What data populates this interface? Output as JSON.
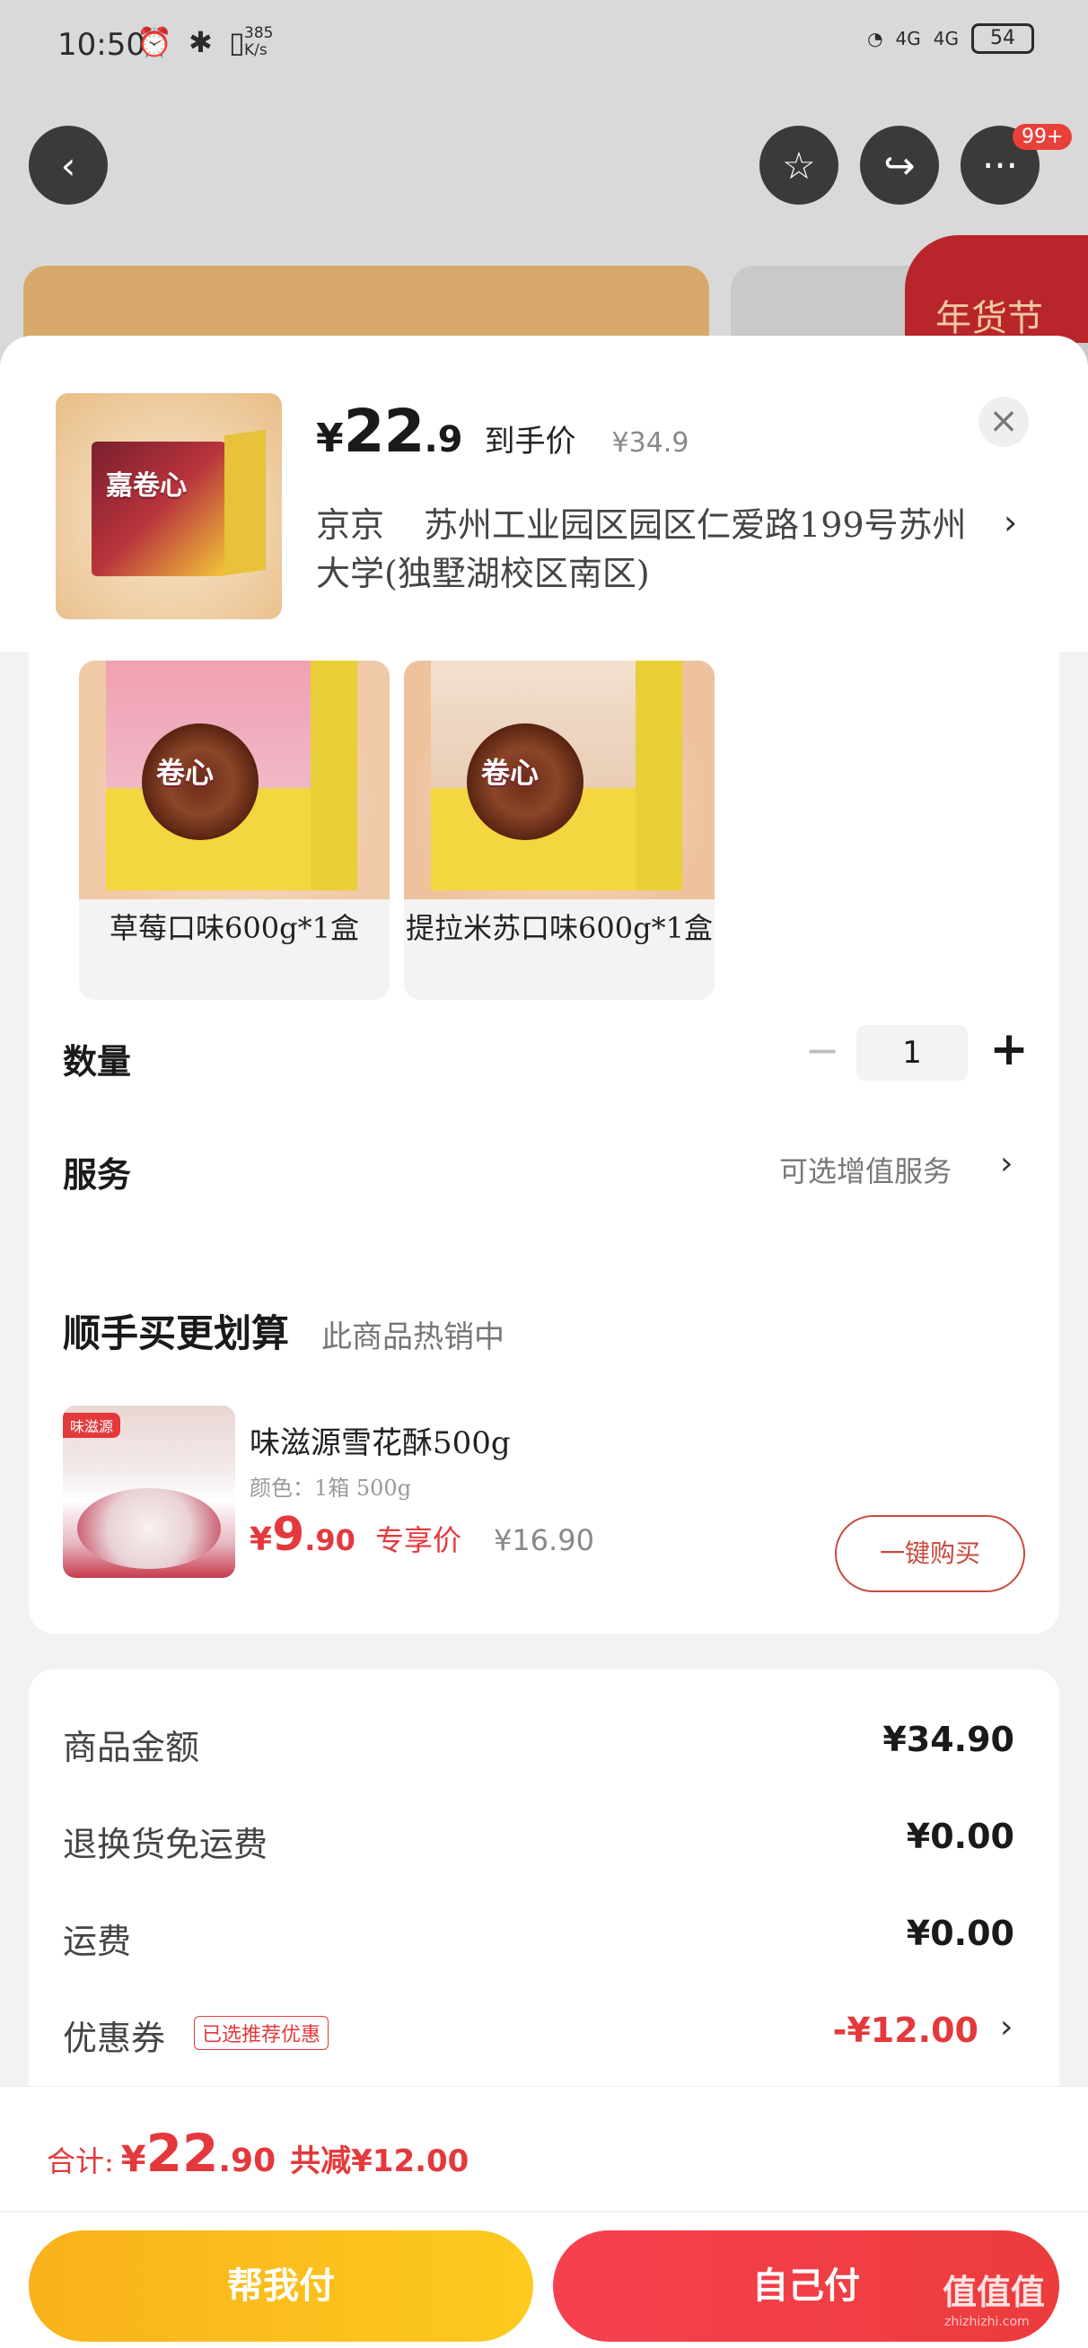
{
  "status_bar": {
    "time": "10:50",
    "icons": "⏰ ✱ ▯",
    "speed": "385\nK/s",
    "signal_1": "4G",
    "signal_2": "4G",
    "battery": "54"
  },
  "top_nav": {
    "back_icon": "‹",
    "favorite_icon": "☆",
    "share_icon": "↪",
    "more_icon": "···",
    "more_badge": "99+"
  },
  "background": {
    "banner_text": "年货节"
  },
  "header": {
    "thumb_brand": "嘉卷心",
    "price": {
      "symbol": "¥",
      "integer": "22",
      "decimal": ".9"
    },
    "price_label": "到手价",
    "original_price": "¥34.9",
    "close_icon": "×",
    "address_name": "京京",
    "address_text": "苏州工业园区园区仁爱路199号苏州大学(独墅湖校区南区)",
    "address_arrow": "›"
  },
  "variants": [
    {
      "label": "草莓口味600g*1盒",
      "brand": "卷心",
      "selected": false
    },
    {
      "label": "提拉米苏口味600g*1盒",
      "brand": "卷心",
      "selected": false
    }
  ],
  "quantity": {
    "label": "数量",
    "minus": "−",
    "value": "1",
    "plus": "+"
  },
  "service": {
    "label": "服务",
    "value": "可选增值服务",
    "arrow": "›"
  },
  "addon": {
    "title": "顺手买更划算",
    "subtitle": "此商品热销中",
    "logo": "味滋源",
    "name": "味滋源雪花酥500g",
    "spec": "颜色：1箱 500g",
    "price": {
      "symbol": "¥",
      "integer": "9",
      "decimal": ".90"
    },
    "price_label": "专享价",
    "original_price": "¥16.90",
    "button": "一键购买"
  },
  "summary": {
    "rows": [
      {
        "label": "商品金额",
        "value": "¥34.90"
      },
      {
        "label": "退换货免运费",
        "value": "¥0.00"
      },
      {
        "label": "运费",
        "value": "¥0.00"
      }
    ],
    "coupon": {
      "label": "优惠券",
      "tag": "已选推荐优惠",
      "value": "-¥12.00",
      "arrow": "›"
    }
  },
  "bottom_bar": {
    "total_label": "合计:",
    "total": {
      "symbol": "¥",
      "integer": "22",
      "decimal": ".90"
    },
    "saving": "共减¥12.00",
    "help_pay": "帮我付",
    "self_pay": "自己付",
    "watermark": "值值值",
    "watermark_sub": "zhizhizhi.com"
  },
  "colors": {
    "accent_red": "#e4393c",
    "help_pay_yellow": "#fdca1e",
    "self_pay_red": "#f6404f"
  }
}
